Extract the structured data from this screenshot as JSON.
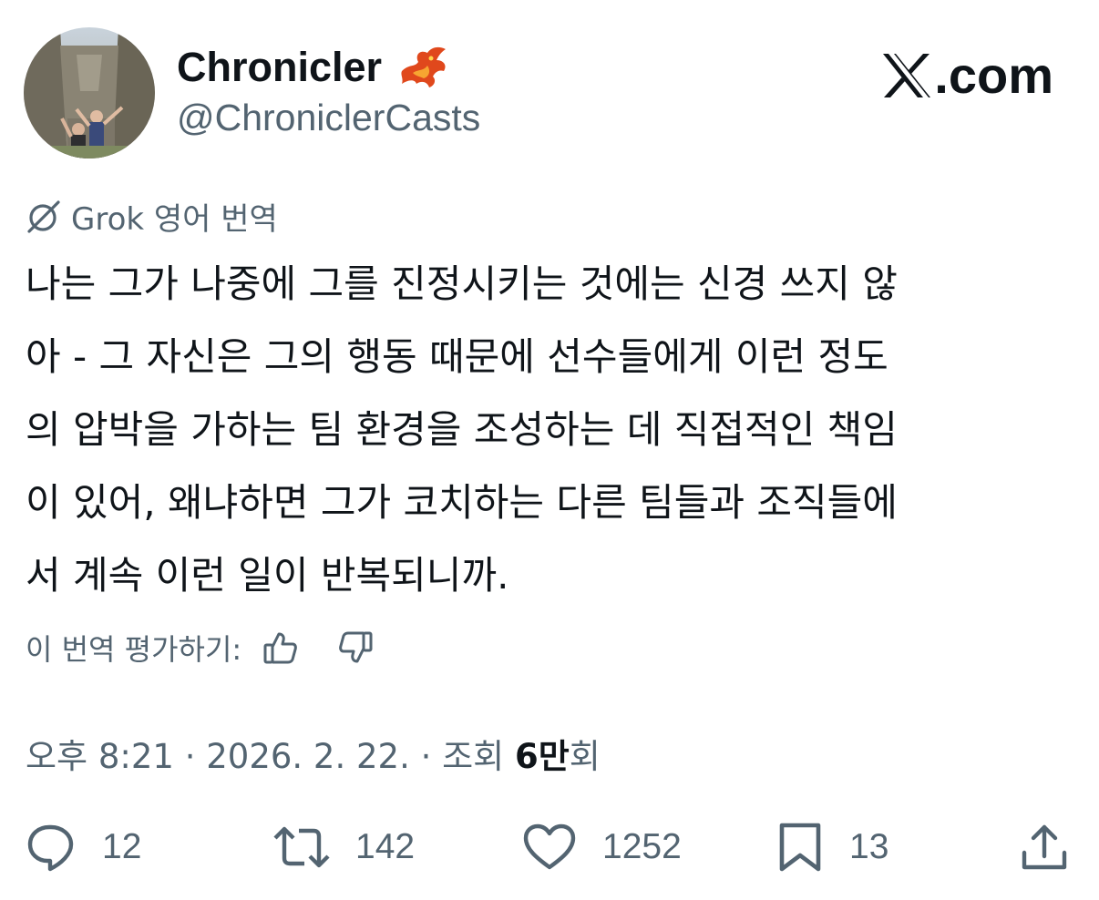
{
  "author": {
    "display_name": "Chronicler",
    "handle": "@ChroniclerCasts",
    "badge_icon": "phoenix-emoji"
  },
  "brand": {
    "logo": "x-logo",
    "domain_suffix": ".com"
  },
  "translation": {
    "label": "Grok 영어 번역",
    "icon": "grok-icon"
  },
  "tweet": {
    "lines": [
      "나는 그가 나중에 그를 진정시키는 것에는 신경 쓰지 않",
      "아 - 그 자신은 그의 행동 때문에 선수들에게 이런 정도",
      "의 압박을 가하는 팀 환경을 조성하는 데 직접적인 책임",
      "이 있어, 왜냐하면 그가 코치하는 다른 팀들과 조직들에",
      "서 계속 이런 일이 반복되니까."
    ]
  },
  "rating": {
    "label": "이 번역 평가하기:",
    "up_icon": "thumbs-up-icon",
    "down_icon": "thumbs-down-icon"
  },
  "meta": {
    "time": "오후 8:21",
    "separator": " · ",
    "date": "2026. 2. 22.",
    "views_label": "조회 ",
    "views_num": "6만",
    "views_unit": "회"
  },
  "actions": {
    "reply": "12",
    "repost": "142",
    "like": "1252",
    "bookmark": "13"
  },
  "colors": {
    "text": "#0f1419",
    "secondary": "#536471",
    "background": "#ffffff"
  }
}
